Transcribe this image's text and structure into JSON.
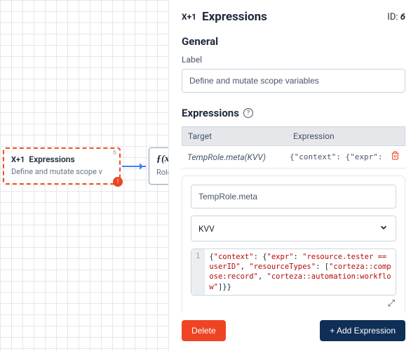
{
  "canvas": {
    "node1": {
      "iconText": "X+1",
      "title": "Expressions",
      "idBadge": "6",
      "subtitle": "Define and mutate scope v",
      "errorBadge": "!"
    },
    "node2": {
      "iconGlyph": "ƒ(x)",
      "subtitle": "Role"
    }
  },
  "panel": {
    "iconText": "X+1",
    "title": "Expressions",
    "idLabel": "ID:",
    "idValue": "6",
    "general": {
      "heading": "General",
      "labelField": "Label",
      "labelValue": "Define and mutate scope variables"
    },
    "expressions": {
      "heading": "Expressions",
      "columns": {
        "target": "Target",
        "expr": "Expression"
      },
      "rows": [
        {
          "target": "TempRole.meta(KVV)",
          "expr": "{\"context\": {\"expr\": \"resourc"
        }
      ],
      "editor": {
        "targetValue": "TempRole.meta",
        "typeValue": "KVV",
        "lineNo": "1",
        "codeTokens": [
          {
            "t": "k",
            "v": "{"
          },
          {
            "t": "s",
            "v": "\"context\""
          },
          {
            "t": "k",
            "v": ": {"
          },
          {
            "t": "s",
            "v": "\"expr\""
          },
          {
            "t": "k",
            "v": ": "
          },
          {
            "t": "s",
            "v": "\"resource.tester == userID\""
          },
          {
            "t": "k",
            "v": ", "
          },
          {
            "t": "s",
            "v": "\"resourceTypes\""
          },
          {
            "t": "k",
            "v": ": ["
          },
          {
            "t": "s",
            "v": "\"corteza::compose:record\""
          },
          {
            "t": "k",
            "v": ", "
          },
          {
            "t": "s",
            "v": "\"corteza::automation:workflow\""
          },
          {
            "t": "k",
            "v": "]}}"
          }
        ]
      }
    },
    "footer": {
      "delete": "Delete",
      "add": "+ Add Expression"
    }
  }
}
